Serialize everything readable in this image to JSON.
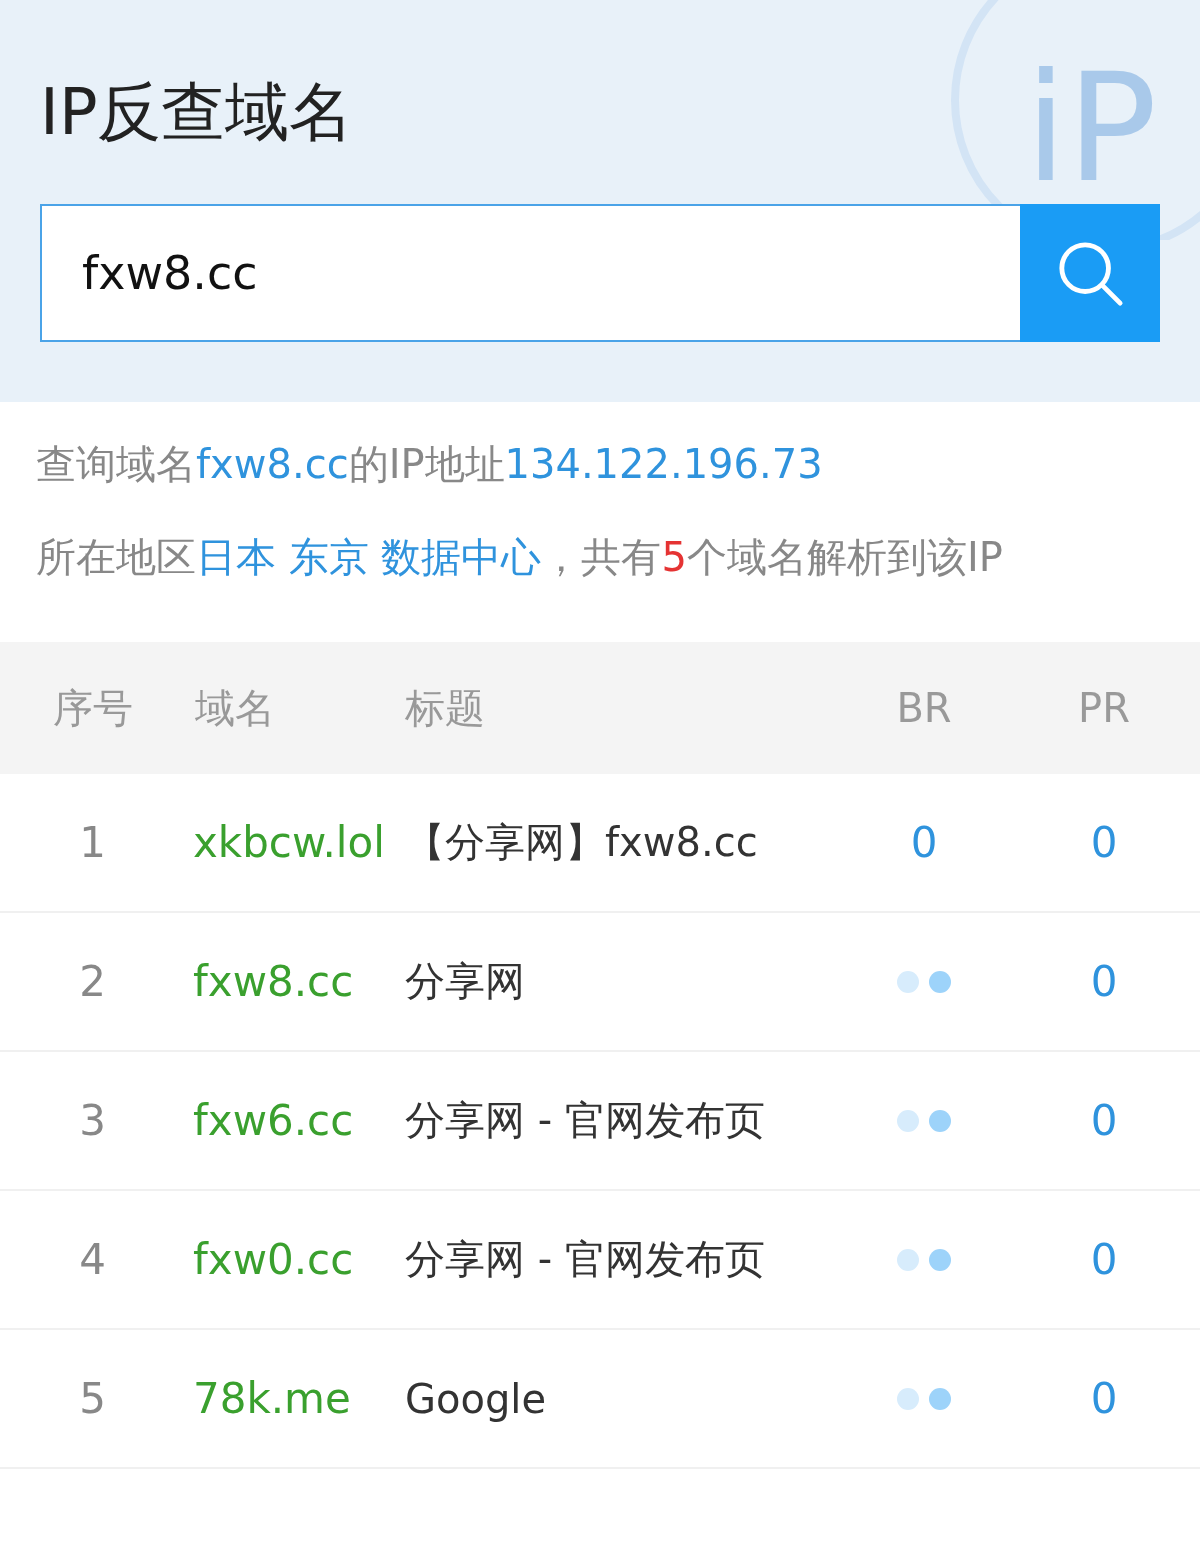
{
  "header": {
    "title": "IP反查域名",
    "logo_text": "iP"
  },
  "search": {
    "value": "fxw8.cc"
  },
  "info": [
    [
      {
        "kind": "plain",
        "text": "查询域名"
      },
      {
        "kind": "link",
        "text": "fxw8.cc"
      },
      {
        "kind": "plain",
        "text": "的IP地址"
      },
      {
        "kind": "link",
        "text": "134.122.196.73"
      }
    ],
    [
      {
        "kind": "plain",
        "text": "所在地区"
      },
      {
        "kind": "link",
        "text": "日本 东京 数据中心"
      },
      {
        "kind": "plain",
        "text": "，共有"
      },
      {
        "kind": "count",
        "text": "5"
      },
      {
        "kind": "plain",
        "text": "个域名解析到该IP"
      }
    ]
  ],
  "table": {
    "columns": [
      "序号",
      "域名",
      "标题",
      "BR",
      "PR"
    ],
    "rows": [
      {
        "index": "1",
        "domain": "xkbcw.lol",
        "title": "【分享网】fxw8.cc",
        "br": {
          "kind": "value",
          "text": "0"
        },
        "pr": "0"
      },
      {
        "index": "2",
        "domain": "fxw8.cc",
        "title": "分享网",
        "br": {
          "kind": "loading"
        },
        "pr": "0"
      },
      {
        "index": "3",
        "domain": "fxw6.cc",
        "title": "分享网 - 官网发布页",
        "br": {
          "kind": "loading"
        },
        "pr": "0"
      },
      {
        "index": "4",
        "domain": "fxw0.cc",
        "title": "分享网 - 官网发布页",
        "br": {
          "kind": "loading"
        },
        "pr": "0"
      },
      {
        "index": "5",
        "domain": "78k.me",
        "title": "Google",
        "br": {
          "kind": "loading"
        },
        "pr": "0"
      }
    ]
  }
}
